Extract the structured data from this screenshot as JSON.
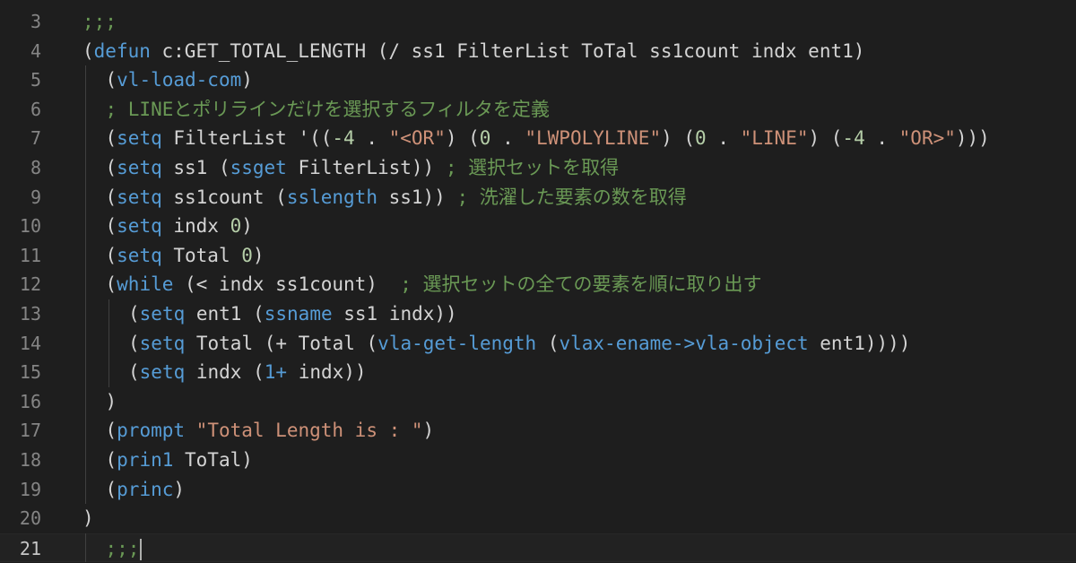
{
  "editor": {
    "top_partial": ";;;",
    "lines": [
      {
        "num": "3",
        "indent": 0,
        "tokens": [
          {
            "t": ";;;",
            "c": "com"
          }
        ]
      },
      {
        "num": "4",
        "indent": 0,
        "tokens": [
          {
            "t": "(",
            "c": "paren"
          },
          {
            "t": "defun",
            "c": "kw"
          },
          {
            "t": " c:GET_TOTAL_LENGTH (/ ss1 FilterList ToTal ss1count indx ent1)",
            "c": "var"
          }
        ]
      },
      {
        "num": "5",
        "indent": 1,
        "tokens": [
          {
            "t": "(",
            "c": "paren"
          },
          {
            "t": "vl-load-com",
            "c": "kw"
          },
          {
            "t": ")",
            "c": "paren"
          }
        ]
      },
      {
        "num": "6",
        "indent": 1,
        "tokens": [
          {
            "t": "; LINEとポリラインだけを選択するフィルタを定義",
            "c": "com"
          }
        ]
      },
      {
        "num": "7",
        "indent": 1,
        "tokens": [
          {
            "t": "(",
            "c": "paren"
          },
          {
            "t": "setq",
            "c": "kw"
          },
          {
            "t": " FilterList '((",
            "c": "var"
          },
          {
            "t": "-4",
            "c": "num"
          },
          {
            "t": " . ",
            "c": "var"
          },
          {
            "t": "\"<OR\"",
            "c": "str"
          },
          {
            "t": ") (",
            "c": "var"
          },
          {
            "t": "0",
            "c": "num"
          },
          {
            "t": " . ",
            "c": "var"
          },
          {
            "t": "\"LWPOLYLINE\"",
            "c": "str"
          },
          {
            "t": ") (",
            "c": "var"
          },
          {
            "t": "0",
            "c": "num"
          },
          {
            "t": " . ",
            "c": "var"
          },
          {
            "t": "\"LINE\"",
            "c": "str"
          },
          {
            "t": ") (",
            "c": "var"
          },
          {
            "t": "-4",
            "c": "num"
          },
          {
            "t": " . ",
            "c": "var"
          },
          {
            "t": "\"OR>\"",
            "c": "str"
          },
          {
            "t": ")))",
            "c": "var"
          }
        ]
      },
      {
        "num": "8",
        "indent": 1,
        "tokens": [
          {
            "t": "(",
            "c": "paren"
          },
          {
            "t": "setq",
            "c": "kw"
          },
          {
            "t": " ss1 (",
            "c": "var"
          },
          {
            "t": "ssget",
            "c": "kw"
          },
          {
            "t": " FilterList)) ",
            "c": "var"
          },
          {
            "t": "; 選択セットを取得",
            "c": "com"
          }
        ]
      },
      {
        "num": "9",
        "indent": 1,
        "tokens": [
          {
            "t": "(",
            "c": "paren"
          },
          {
            "t": "setq",
            "c": "kw"
          },
          {
            "t": " ss1count (",
            "c": "var"
          },
          {
            "t": "sslength",
            "c": "kw"
          },
          {
            "t": " ss1)) ",
            "c": "var"
          },
          {
            "t": "; 洗濯した要素の数を取得",
            "c": "com"
          }
        ]
      },
      {
        "num": "10",
        "indent": 1,
        "tokens": [
          {
            "t": "(",
            "c": "paren"
          },
          {
            "t": "setq",
            "c": "kw"
          },
          {
            "t": " indx ",
            "c": "var"
          },
          {
            "t": "0",
            "c": "num"
          },
          {
            "t": ")",
            "c": "var"
          }
        ]
      },
      {
        "num": "11",
        "indent": 1,
        "tokens": [
          {
            "t": "(",
            "c": "paren"
          },
          {
            "t": "setq",
            "c": "kw"
          },
          {
            "t": " Total ",
            "c": "var"
          },
          {
            "t": "0",
            "c": "num"
          },
          {
            "t": ")",
            "c": "var"
          }
        ]
      },
      {
        "num": "12",
        "indent": 1,
        "tokens": [
          {
            "t": "(",
            "c": "paren"
          },
          {
            "t": "while",
            "c": "kw"
          },
          {
            "t": " (< indx ss1count)  ",
            "c": "var"
          },
          {
            "t": "; 選択セットの全ての要素を順に取り出す",
            "c": "com"
          }
        ]
      },
      {
        "num": "13",
        "indent": 2,
        "tokens": [
          {
            "t": "(",
            "c": "paren"
          },
          {
            "t": "setq",
            "c": "kw"
          },
          {
            "t": " ent1 (",
            "c": "var"
          },
          {
            "t": "ssname",
            "c": "kw"
          },
          {
            "t": " ss1 indx))",
            "c": "var"
          }
        ]
      },
      {
        "num": "14",
        "indent": 2,
        "tokens": [
          {
            "t": "(",
            "c": "paren"
          },
          {
            "t": "setq",
            "c": "kw"
          },
          {
            "t": " Total (+ Total (",
            "c": "var"
          },
          {
            "t": "vla-get-length",
            "c": "kw"
          },
          {
            "t": " (",
            "c": "var"
          },
          {
            "t": "vlax-ename->vla-object",
            "c": "kw"
          },
          {
            "t": " ent1))))",
            "c": "var"
          }
        ]
      },
      {
        "num": "15",
        "indent": 2,
        "tokens": [
          {
            "t": "(",
            "c": "paren"
          },
          {
            "t": "setq",
            "c": "kw"
          },
          {
            "t": " indx (",
            "c": "var"
          },
          {
            "t": "1+",
            "c": "kw"
          },
          {
            "t": " indx))",
            "c": "var"
          }
        ]
      },
      {
        "num": "16",
        "indent": 1,
        "tokens": [
          {
            "t": ")",
            "c": "paren"
          }
        ]
      },
      {
        "num": "17",
        "indent": 1,
        "tokens": [
          {
            "t": "(",
            "c": "paren"
          },
          {
            "t": "prompt",
            "c": "kw"
          },
          {
            "t": " ",
            "c": "var"
          },
          {
            "t": "\"Total Length is : \"",
            "c": "str"
          },
          {
            "t": ")",
            "c": "var"
          }
        ]
      },
      {
        "num": "18",
        "indent": 1,
        "tokens": [
          {
            "t": "(",
            "c": "paren"
          },
          {
            "t": "prin1",
            "c": "kw"
          },
          {
            "t": " ToTal)",
            "c": "var"
          }
        ]
      },
      {
        "num": "19",
        "indent": 1,
        "tokens": [
          {
            "t": "(",
            "c": "paren"
          },
          {
            "t": "princ",
            "c": "kw"
          },
          {
            "t": ")",
            "c": "paren"
          }
        ]
      },
      {
        "num": "20",
        "indent": 0,
        "tokens": [
          {
            "t": ")",
            "c": "paren"
          }
        ]
      },
      {
        "num": "21",
        "indent": 1,
        "tokens": [
          {
            "t": ";;;",
            "c": "com"
          }
        ],
        "current": true,
        "cursor": true
      }
    ]
  },
  "colors": {
    "background": "#1e1e1e",
    "keyword": "#569cd6",
    "string": "#ce9178",
    "number": "#b5cea8",
    "comment": "#6a9955",
    "text": "#d4d4d4",
    "line_number": "#858585"
  }
}
